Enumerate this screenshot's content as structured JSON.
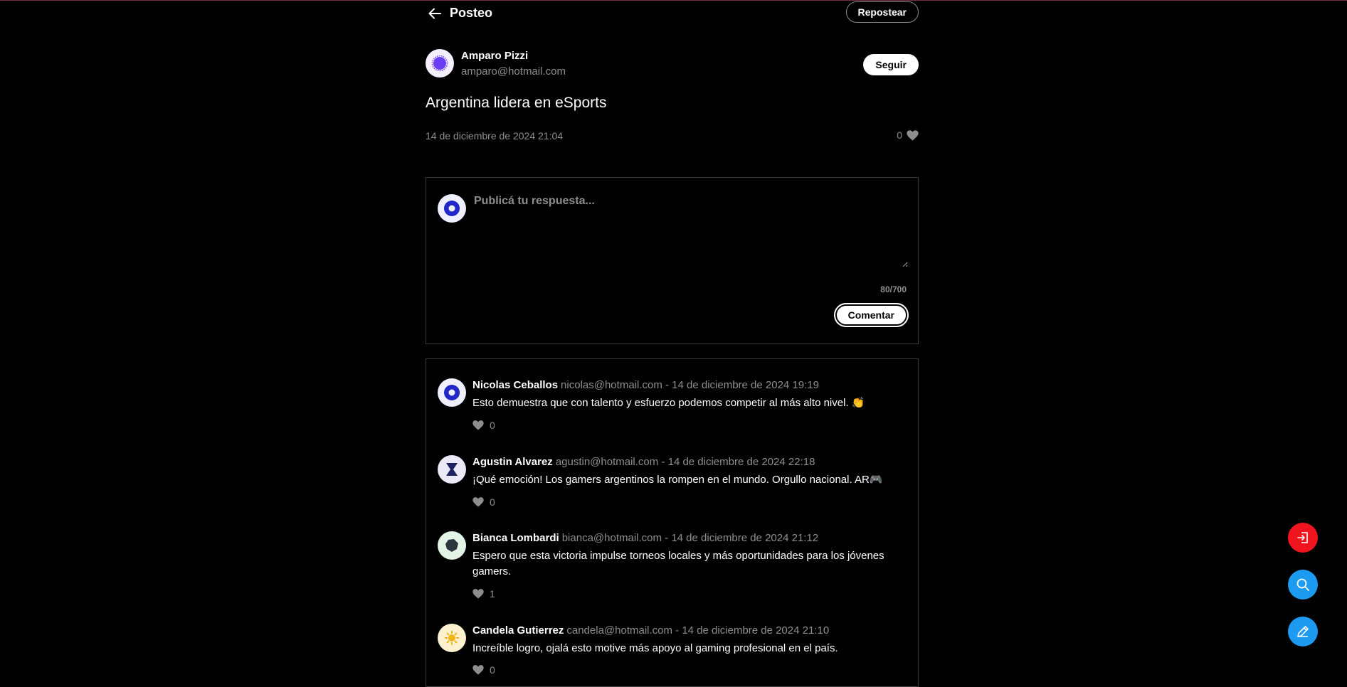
{
  "header": {
    "title": "Posteo",
    "repost_label": "Repostear"
  },
  "post": {
    "author_name": "Amparo Pizzi",
    "author_email": "amparo@hotmail.com",
    "follow_label": "Seguir",
    "title": "Argentina lidera en eSports",
    "date": "14 de diciembre de 2024 21:04",
    "likes": "0"
  },
  "reply": {
    "placeholder": "Publicá tu respuesta...",
    "counter": "80/700",
    "submit_label": "Comentar"
  },
  "comments": [
    {
      "name": "Nicolas Ceballos",
      "meta": "nicolas@hotmail.com - 14 de diciembre de 2024 19:19",
      "text": "Esto demuestra que con talento y esfuerzo podemos competir al más alto nivel. 👏",
      "likes": "0"
    },
    {
      "name": "Agustin Alvarez",
      "meta": "agustin@hotmail.com - 14 de diciembre de 2024 22:18",
      "text": "¡Qué emoción! Los gamers argentinos la rompen en el mundo. Orgullo nacional. AR🎮",
      "likes": "0"
    },
    {
      "name": "Bianca Lombardi",
      "meta": "bianca@hotmail.com - 14 de diciembre de 2024 21:12",
      "text": "Espero que esta victoria impulse torneos locales y más oportunidades para los jóvenes gamers.",
      "likes": "1"
    },
    {
      "name": "Candela Gutierrez",
      "meta": "candela@hotmail.com - 14 de diciembre de 2024 21:10",
      "text": "Increíble logro, ojalá esto motive más apoyo al gaming profesional en el país.",
      "likes": "0"
    }
  ],
  "icons": {
    "back": "arrow-left-icon",
    "like": "heart-icon",
    "logout": "logout-icon",
    "search": "search-icon",
    "edit": "pencil-icon"
  },
  "colors": {
    "background": "#000000",
    "logout_fab": "#f0141e",
    "action_fab": "#1d9bf0",
    "muted_text": "#8e8e8e"
  }
}
